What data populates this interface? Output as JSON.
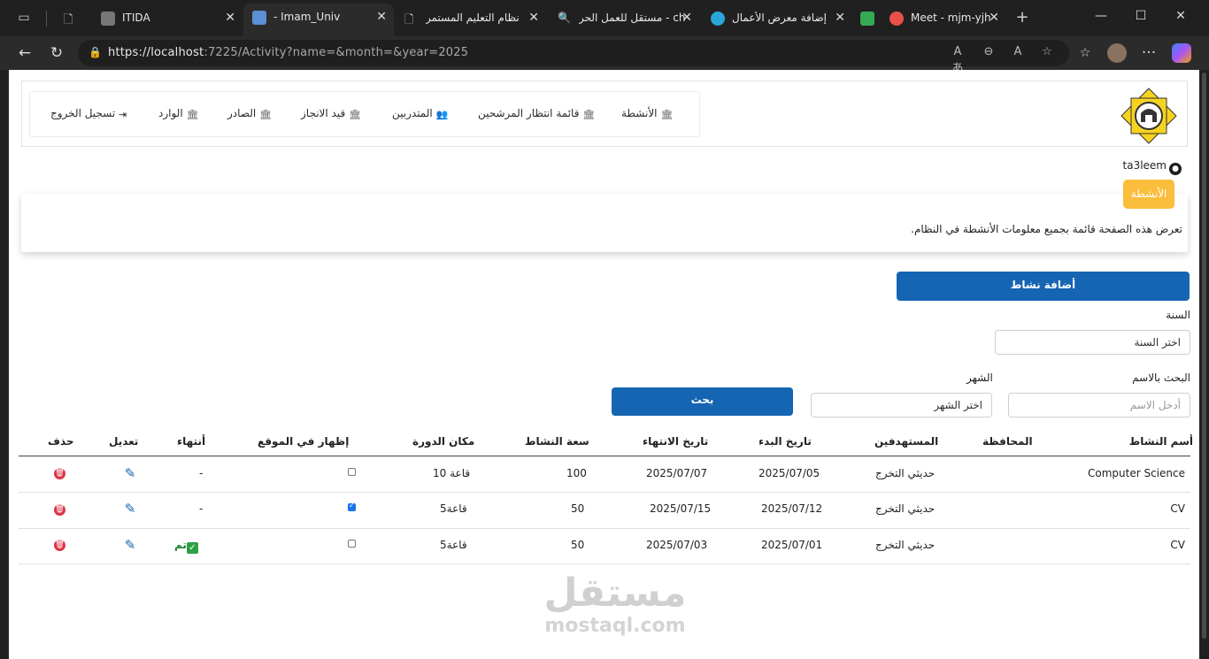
{
  "browser": {
    "tabs": [
      {
        "title": "ITIDA"
      },
      {
        "title": "- Imam_Univ"
      },
      {
        "title": "نظام التعليم المستمر"
      },
      {
        "title": "مستقل للعمل الحر - ch"
      },
      {
        "title": "إضافة معرض الأعمال"
      },
      {
        "title": "Meet - mjm-yjh"
      }
    ],
    "url_host": "https://localhost",
    "url_rest": ":7225/Activity?name=&month=&year=2025"
  },
  "nav": {
    "items": [
      {
        "label": "الأنشطة"
      },
      {
        "label": "قائمة انتظار المرشحين"
      },
      {
        "label": "المتدربين"
      },
      {
        "label": "قيد الانجاز"
      },
      {
        "label": "الصادر"
      },
      {
        "label": "الوارد"
      },
      {
        "label": "تسجيل الخروج"
      }
    ]
  },
  "user": {
    "name": "ta3leem"
  },
  "page": {
    "badge": "الأنشطة",
    "description": "تعرض هذه الصفحة قائمة بجميع معلومات الأنشطة في النظام."
  },
  "actions": {
    "add_label": "أضافة نشاط",
    "search_label": "بحث"
  },
  "filters": {
    "year_label": "السنة",
    "year_value": "اختر السنة",
    "name_label": "البحث بالاسم",
    "name_placeholder": "أدخل الاسم",
    "month_label": "الشهر",
    "month_value": "اختر الشهر"
  },
  "table": {
    "headers": {
      "name": "أسم النشاط",
      "governorate": "المحافظة",
      "target": "المستهدفين",
      "start": "تاريخ البدء",
      "end": "تاريخ الانتهاء",
      "capacity": "سعة النشاط",
      "place": "مكان الدورة",
      "show": "إظهار في الموقع",
      "finish": "أنتهاء",
      "edit": "تعديل",
      "delete": "حذف"
    },
    "rows": [
      {
        "name": "Computer Science",
        "governorate": "",
        "target": "حديثي التخرج",
        "start": "2025/07/05",
        "end": "2025/07/07",
        "capacity": "100",
        "place": "قاعة 10",
        "show": false,
        "finish": "-"
      },
      {
        "name": "CV",
        "governorate": "",
        "target": "حديثي التخرج",
        "start": "2025/07/12",
        "end": "2025/07/15",
        "capacity": "50",
        "place": "قاعة5",
        "show": true,
        "finish": "-"
      },
      {
        "name": "CV",
        "governorate": "",
        "target": "حديثي التخرج",
        "start": "2025/07/01",
        "end": "2025/07/03",
        "capacity": "50",
        "place": "قاعة5",
        "show": false,
        "finish": "تم"
      }
    ]
  },
  "watermark": {
    "arabic": "مستقل",
    "latin": "mostaql.com"
  },
  "colors": {
    "primary": "#1565b2",
    "badge": "#fbbd3c",
    "danger": "#dc3545",
    "success": "#2ea043"
  }
}
